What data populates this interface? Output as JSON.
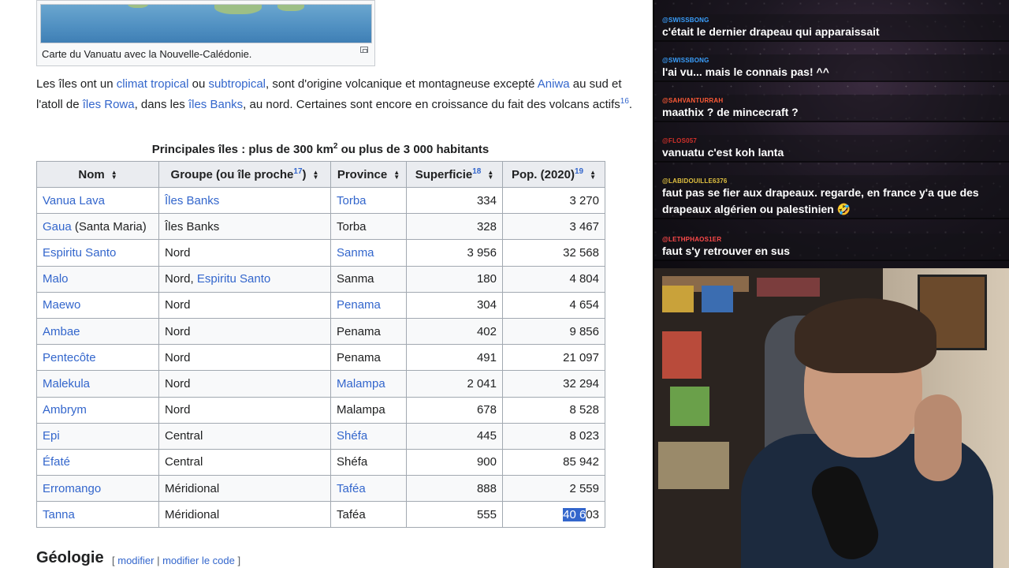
{
  "thumbnail": {
    "caption": "Carte du Vanuatu avec la Nouvelle-Calédonie."
  },
  "paragraph": {
    "p1": "Les îles ont un ",
    "link_climat": "climat tropical",
    "p2": " ou ",
    "link_subtropical": "subtropical",
    "p3": ", sont d'origine volcanique et montagneuse excepté ",
    "link_aniwa": "Aniwa",
    "p4": " au sud et l'atoll de ",
    "link_rowa": "îles Rowa",
    "p5": ", dans les ",
    "link_banks": "îles Banks",
    "p6": ", au nord. Certaines sont encore en croissance du fait des volcans actifs",
    "ref": "16",
    "p7": "."
  },
  "table": {
    "caption_main": "Principales îles : plus de 300 km",
    "caption_sup": "2",
    "caption_rest": " ou plus de 3 000 habitants",
    "headers": {
      "nom": "Nom",
      "groupe": "Groupe (ou île proche",
      "groupe_ref": "17",
      "groupe_end": ")",
      "province": "Province",
      "superficie": "Superficie",
      "superficie_ref": "18",
      "pop": "Pop. (2020)",
      "pop_ref": "19"
    },
    "rows": [
      {
        "nom": "Vanua Lava",
        "nom_extra": "",
        "groupe": "Îles Banks",
        "groupe_extra": "",
        "province": "Torba",
        "superficie": "334",
        "pop": "3 270"
      },
      {
        "nom": "Gaua",
        "nom_extra": " (Santa Maria)",
        "groupe": "Îles Banks",
        "groupe_extra": "",
        "province": "Torba",
        "superficie": "328",
        "pop": "3 467"
      },
      {
        "nom": "Espiritu Santo",
        "nom_extra": "",
        "groupe": "Nord",
        "groupe_extra": "",
        "province": "Sanma",
        "superficie": "3 956",
        "pop": "32 568"
      },
      {
        "nom": "Malo",
        "nom_extra": "",
        "groupe": "Nord, ",
        "groupe_extra": "Espiritu Santo",
        "province": "Sanma",
        "superficie": "180",
        "pop": "4 804"
      },
      {
        "nom": "Maewo",
        "nom_extra": "",
        "groupe": "Nord",
        "groupe_extra": "",
        "province": "Penama",
        "superficie": "304",
        "pop": "4 654"
      },
      {
        "nom": "Ambae",
        "nom_extra": "",
        "groupe": "Nord",
        "groupe_extra": "",
        "province": "Penama",
        "superficie": "402",
        "pop": "9 856"
      },
      {
        "nom": "Pentecôte",
        "nom_extra": "",
        "groupe": "Nord",
        "groupe_extra": "",
        "province": "Penama",
        "superficie": "491",
        "pop": "21 097"
      },
      {
        "nom": "Malekula",
        "nom_extra": "",
        "groupe": "Nord",
        "groupe_extra": "",
        "province": "Malampa",
        "superficie": "2 041",
        "pop": "32 294"
      },
      {
        "nom": "Ambrym",
        "nom_extra": "",
        "groupe": "Nord",
        "groupe_extra": "",
        "province": "Malampa",
        "superficie": "678",
        "pop": "8 528"
      },
      {
        "nom": "Epi",
        "nom_extra": "",
        "groupe": "Central",
        "groupe_extra": "",
        "province": "Shéfa",
        "superficie": "445",
        "pop": "8 023"
      },
      {
        "nom": "Éfaté",
        "nom_extra": "",
        "groupe": "Central",
        "groupe_extra": "",
        "province": "Shéfa",
        "superficie": "900",
        "pop": "85 942"
      },
      {
        "nom": "Erromango",
        "nom_extra": "",
        "groupe": "Méridional",
        "groupe_extra": "",
        "province": "Taféa",
        "superficie": "888",
        "pop": "2 559"
      },
      {
        "nom": "Tanna",
        "nom_extra": "",
        "groupe": "Méridional",
        "groupe_extra": "",
        "province": "Taféa",
        "superficie": "555",
        "pop_selected": "40 6",
        "pop": "03"
      }
    ]
  },
  "section": {
    "title": "Géologie",
    "edit_open": "[ ",
    "edit": "modifier",
    "sep": " | ",
    "edit_code": "modifier le code",
    "edit_close": " ]"
  },
  "chat": {
    "messages": [
      {
        "user": "@SWISSBONG",
        "color": "#3aa0ff",
        "text": "c'était le dernier drapeau qui apparaissait"
      },
      {
        "user": "@SWISSBONG",
        "color": "#3aa0ff",
        "text": "l'ai vu... mais le connais pas! ^^"
      },
      {
        "user": "@SAHVANTURRAH",
        "color": "#ff5a36",
        "text": "maathix ? de mincecraft ?"
      },
      {
        "user": "@FLOS057",
        "color": "#d0302a",
        "text": "vanuatu c'est koh lanta"
      },
      {
        "user": "@LABIDOUILLE6376",
        "color": "#e0c040",
        "text": "faut pas se fier aux drapeaux. regarde, en france y'a que des drapeaux algérien ou palestinien 🤣"
      },
      {
        "user": "@LETHPHAOS1ER",
        "color": "#ff4a4a",
        "text": "faut s'y retrouver en sus"
      }
    ]
  }
}
